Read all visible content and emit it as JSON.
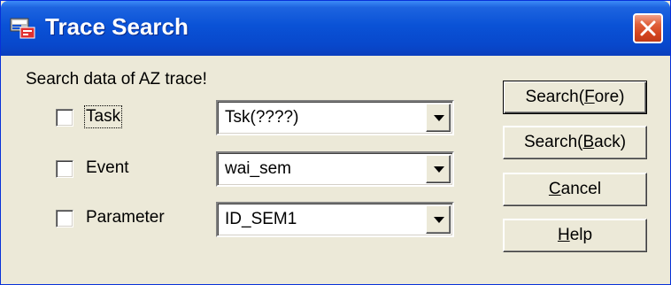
{
  "window": {
    "title": "Trace Search",
    "icon": "trace-app-icon",
    "close_icon": "close-x-icon"
  },
  "prompt": "Search data of AZ trace!",
  "criteria": [
    {
      "label": "Task",
      "checked": false,
      "value": "Tsk(????)"
    },
    {
      "label": "Event",
      "checked": false,
      "value": "wai_sem"
    },
    {
      "label": "Parameter",
      "checked": false,
      "value": "ID_SEM1"
    }
  ],
  "buttons": {
    "search_fore": {
      "text": "Search(",
      "mnemonic": "F",
      "rest": "ore)"
    },
    "search_back": {
      "text": "Search(",
      "mnemonic": "B",
      "rest": "ack)"
    },
    "cancel": {
      "text": "",
      "mnemonic": "C",
      "rest": "ancel"
    },
    "help": {
      "text": "",
      "mnemonic": "H",
      "rest": "elp"
    }
  },
  "colors": {
    "titlebar": "#0a52d6",
    "close": "#d4451f",
    "face": "#ece9d8"
  }
}
